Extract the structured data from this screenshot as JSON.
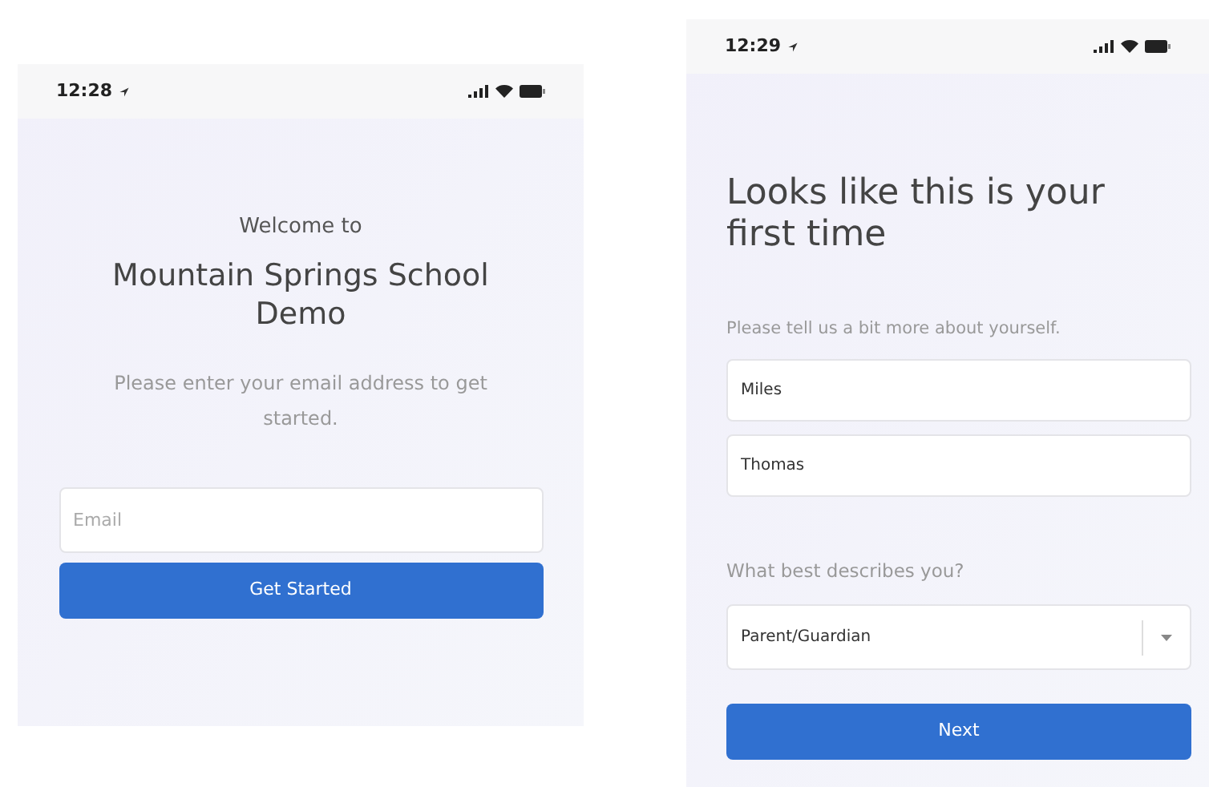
{
  "welcome_screen": {
    "status_time": "12:28",
    "greeting": "Welcome to",
    "title": "Mountain Springs School Demo",
    "prompt": "Please enter your email address to get started.",
    "email_field": {
      "placeholder": "Email"
    },
    "button": "Get Started"
  },
  "profile_screen": {
    "status_time": "12:29",
    "heading": "Looks like this is your first time",
    "prompt": "Please tell us a bit more about yourself.",
    "first_name_field": {
      "value": "Miles"
    },
    "last_name_field": {
      "value": "Thomas"
    },
    "role_label": "What best describes you?",
    "role_select": {
      "value": "Parent/Guardian"
    },
    "button": "Next"
  }
}
